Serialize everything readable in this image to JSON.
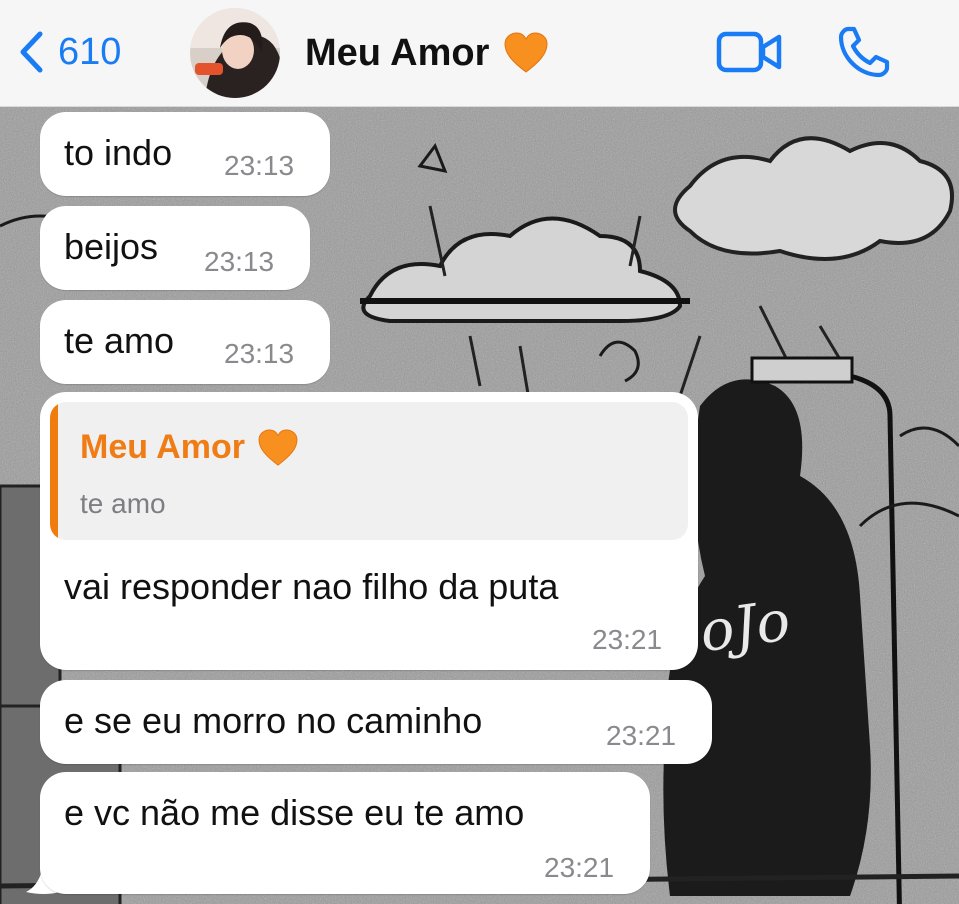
{
  "header": {
    "back_count": "610",
    "contact_name": "Meu Amor",
    "contact_emoji": "orange-heart"
  },
  "messages": [
    {
      "text": "to indo",
      "time": "23:13"
    },
    {
      "text": "beijos",
      "time": "23:13"
    },
    {
      "text": "te amo",
      "time": "23:13"
    },
    {
      "text": "vai responder nao filho da puta",
      "time": "23:21",
      "reply": {
        "author": "Meu Amor",
        "text": "te amo"
      }
    },
    {
      "text": "e se eu morro no caminho",
      "time": "23:21"
    },
    {
      "text": "e vc não me disse eu te amo",
      "time": "23:21"
    }
  ],
  "colors": {
    "accent_blue": "#1a7cf5",
    "reply_orange": "#ef7c14",
    "bubble": "#ffffff",
    "header_bg": "#f6f6f7"
  },
  "icons": [
    "chevron-left-icon",
    "video-camera-icon",
    "phone-icon",
    "orange-heart-icon"
  ]
}
